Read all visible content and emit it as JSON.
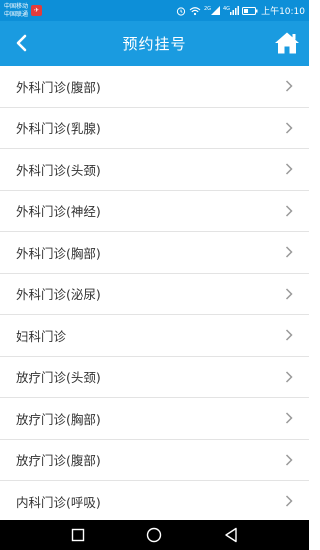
{
  "status_bar": {
    "carrier_1": "中国移动",
    "carrier_2": "中国联通",
    "signal_label_1": "2G",
    "signal_label_2": "4G",
    "time": "上午10:10"
  },
  "header": {
    "title": "预约挂号"
  },
  "list": {
    "items": [
      {
        "label": "外科门诊(腹部)"
      },
      {
        "label": "外科门诊(乳腺)"
      },
      {
        "label": "外科门诊(头颈)"
      },
      {
        "label": "外科门诊(神经)"
      },
      {
        "label": "外科门诊(胸部)"
      },
      {
        "label": "外科门诊(泌尿)"
      },
      {
        "label": "妇科门诊"
      },
      {
        "label": "放疗门诊(头颈)"
      },
      {
        "label": "放疗门诊(胸部)"
      },
      {
        "label": "放疗门诊(腹部)"
      },
      {
        "label": "内科门诊(呼吸)"
      }
    ]
  },
  "icons": {
    "back": "chevron-left-icon",
    "home": "home-icon",
    "row": "chevron-right-icon",
    "nav": [
      "square-recents-icon",
      "circle-home-icon",
      "triangle-back-icon"
    ]
  },
  "colors": {
    "status_bar": "#0d8fd8",
    "header": "#1a9be0",
    "text": "#333333",
    "divider": "#e3e3e3",
    "chevron": "#9a9a9a",
    "nav_bar": "#000000"
  }
}
